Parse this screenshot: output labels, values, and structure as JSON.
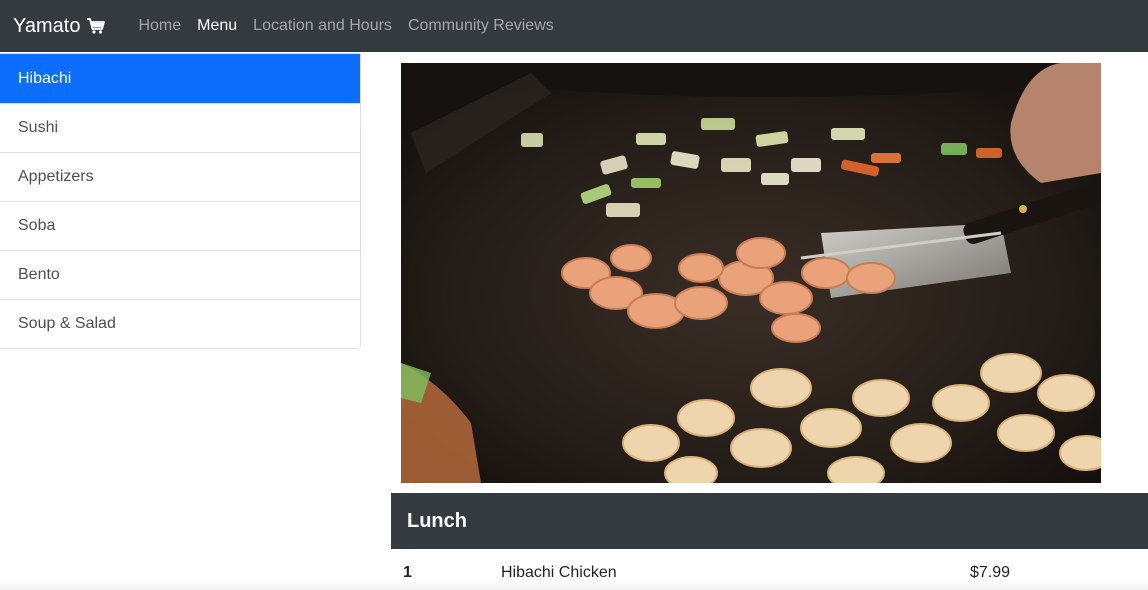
{
  "navbar": {
    "brand": "Yamato",
    "brand_icon": "cart-icon",
    "links": [
      {
        "label": "Home",
        "active": false
      },
      {
        "label": "Menu",
        "active": true
      },
      {
        "label": "Location and Hours",
        "active": false
      },
      {
        "label": "Community Reviews",
        "active": false
      }
    ]
  },
  "sidebar": {
    "items": [
      {
        "label": "Hibachi",
        "active": true
      },
      {
        "label": "Sushi",
        "active": false
      },
      {
        "label": "Appetizers",
        "active": false
      },
      {
        "label": "Soba",
        "active": false
      },
      {
        "label": "Bento",
        "active": false
      },
      {
        "label": "Soup & Salad",
        "active": false
      }
    ]
  },
  "hero": {
    "image": "hibachi-shrimp-grill-photo"
  },
  "menu": {
    "section_title": "Lunch",
    "rows": [
      {
        "number": "1",
        "name": "Hibachi Chicken",
        "price": "$7.99"
      }
    ]
  },
  "colors": {
    "navbar": "#343a40",
    "active_item": "#0d6efd",
    "section_header": "#343a40"
  }
}
